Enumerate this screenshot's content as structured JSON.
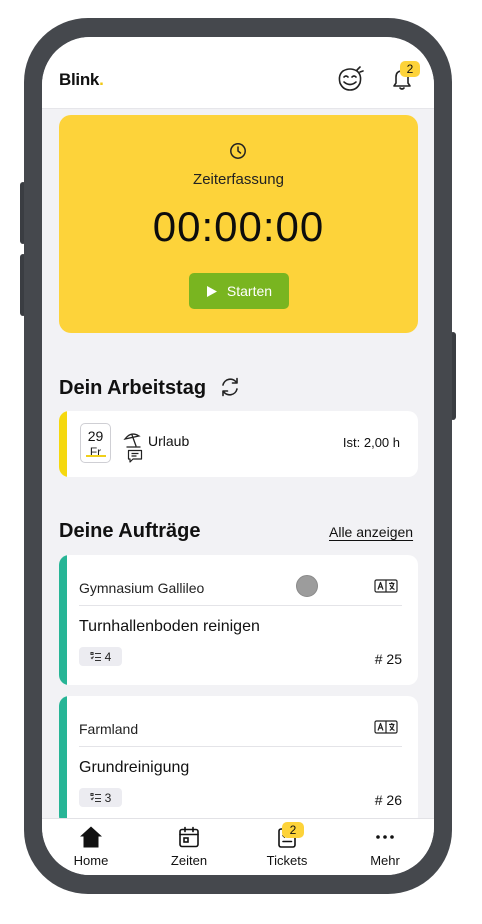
{
  "header": {
    "logo_text": "Blink",
    "logo_dot": ".",
    "notification_count": "2"
  },
  "time_tracking": {
    "title": "Zeiterfassung",
    "value": "00:00:00",
    "start_label": "Starten"
  },
  "workday": {
    "heading": "Dein Arbeitstag",
    "date_day": "29",
    "date_weekday": "Fr",
    "entry_label": "Urlaub",
    "hours_label": "Ist: 2,00 h",
    "accent_color": "#f5d80e"
  },
  "orders": {
    "heading": "Deine Aufträge",
    "show_all_label": "Alle anzeigen",
    "accent_color": "#27b596",
    "items": [
      {
        "client": "Gymnasium Gallileo",
        "title": "Turnhallenboden reinigen",
        "task_count": "4",
        "number": "# 25"
      },
      {
        "client": "Farmland",
        "title": "Grundreinigung",
        "task_count": "3",
        "number": "# 26"
      }
    ]
  },
  "bottom_nav": {
    "items": [
      {
        "label": "Home",
        "icon": "home-icon"
      },
      {
        "label": "Zeiten",
        "icon": "calendar-icon"
      },
      {
        "label": "Tickets",
        "icon": "tickets-icon",
        "badge": "2"
      },
      {
        "label": "Mehr",
        "icon": "more-icon"
      }
    ]
  }
}
